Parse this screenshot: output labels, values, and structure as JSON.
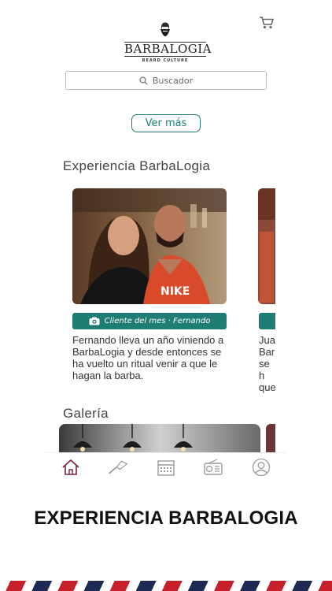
{
  "header": {
    "logo_text": "BARBALOGIA",
    "logo_subtitle": "BEARD CULTURE",
    "cart_icon": "cart-icon"
  },
  "search": {
    "placeholder": "Buscador",
    "icon": "search-icon"
  },
  "ver_mas_label": "Ver más",
  "experiencia": {
    "title": "Experiencia BarbaLogia",
    "cards": [
      {
        "caption": "Cliente del mes · Fernando",
        "text": "Fernando lleva un año viniendo a BarbaLogia y desde entonces se ha vuelto un ritual venir a que le hagan la barba."
      },
      {
        "text": "Juan\nBarb\nse h\nque"
      }
    ]
  },
  "galeria": {
    "title": "Galería"
  },
  "tabbar": {
    "items": [
      "home-icon",
      "razor-icon",
      "calendar-icon",
      "radio-icon",
      "profile-icon"
    ],
    "active_color": "#7a2236",
    "inactive_color": "#9a9a9a"
  },
  "footer": {
    "title": "EXPERIENCIA BARBALOGIA"
  },
  "colors": {
    "accent": "#1f7e73",
    "stripe_red": "#c8202b",
    "stripe_blue": "#1d2b54"
  }
}
